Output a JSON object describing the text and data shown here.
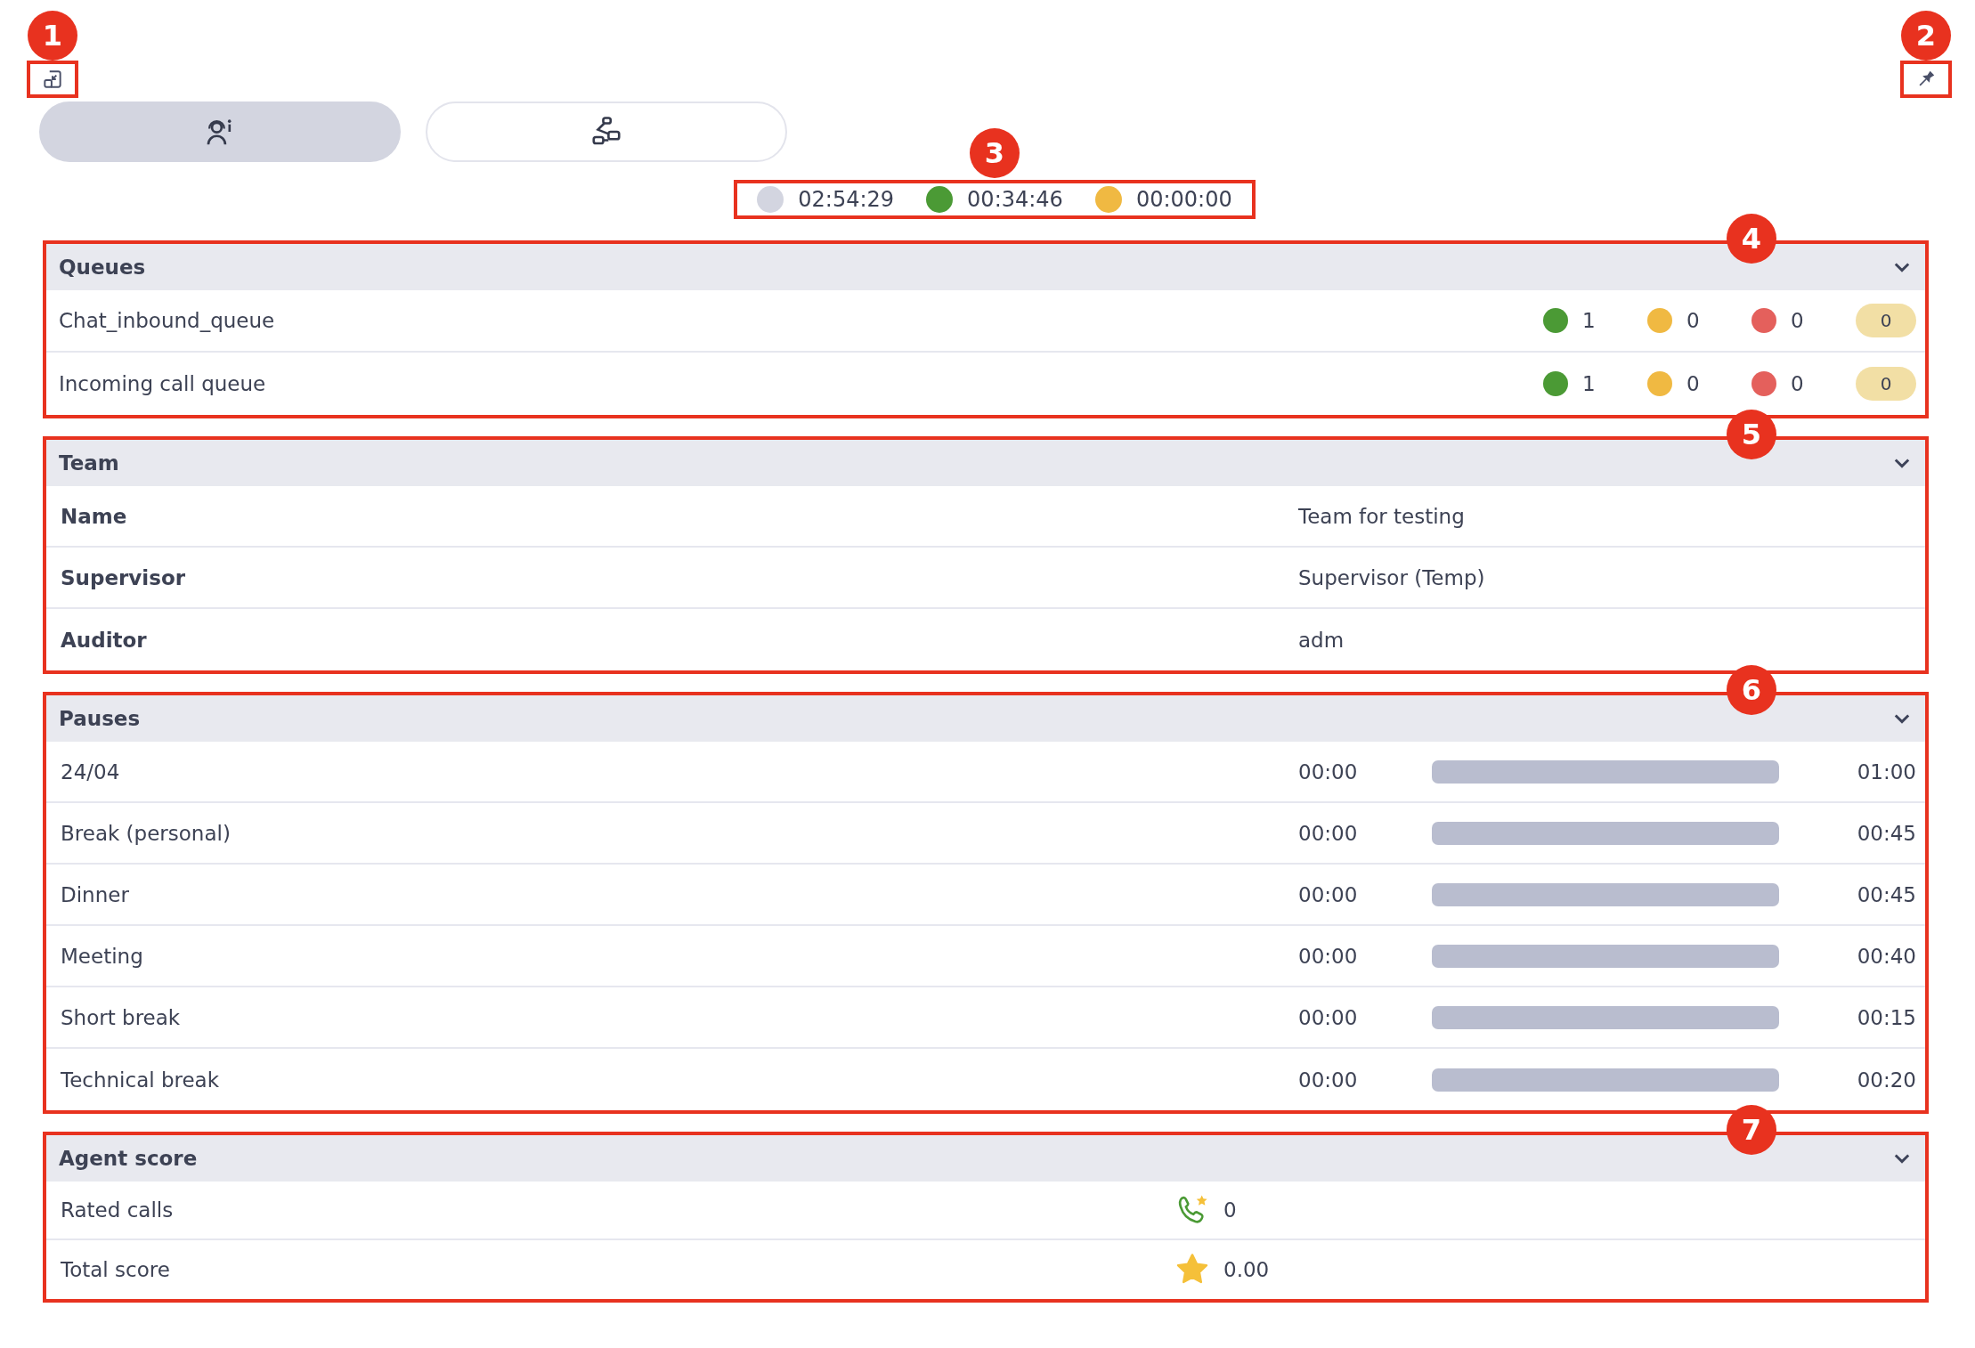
{
  "top_bar": {
    "left_callout": "1",
    "right_callout": "2"
  },
  "tabs": [
    {
      "kind": "agent",
      "selected": true
    },
    {
      "kind": "flow",
      "selected": false
    }
  ],
  "timers": {
    "callout": "3",
    "items": [
      {
        "color": "#d3d5e0",
        "value": "02:54:29"
      },
      {
        "color": "#4b9a35",
        "value": "00:34:46"
      },
      {
        "color": "#f0b942",
        "value": "00:00:00"
      }
    ]
  },
  "queues": {
    "title": "Queues",
    "callout": "4",
    "expanded": true,
    "rows": [
      {
        "name": "Chat_inbound_queue",
        "counts": [
          {
            "color": "#4b9a35",
            "value": "1"
          },
          {
            "color": "#f0b942",
            "value": "0"
          },
          {
            "color": "#e4605c",
            "value": "0"
          }
        ],
        "badge": "0"
      },
      {
        "name": "Incoming call queue",
        "counts": [
          {
            "color": "#4b9a35",
            "value": "1"
          },
          {
            "color": "#f0b942",
            "value": "0"
          },
          {
            "color": "#e4605c",
            "value": "0"
          }
        ],
        "badge": "0"
      }
    ]
  },
  "team": {
    "title": "Team",
    "callout": "5",
    "expanded": true,
    "rows": [
      {
        "label": "Name",
        "value": "Team for testing"
      },
      {
        "label": "Supervisor",
        "value": "Supervisor (Temp)"
      },
      {
        "label": "Auditor",
        "value": "adm"
      }
    ]
  },
  "pauses": {
    "title": "Pauses",
    "callout": "6",
    "expanded": true,
    "rows": [
      {
        "name": "24/04",
        "used": "00:00",
        "level": 0,
        "limit": "01:00"
      },
      {
        "name": "Break (personal)",
        "used": "00:00",
        "level": 0,
        "limit": "00:45"
      },
      {
        "name": "Dinner",
        "used": "00:00",
        "level": 0,
        "limit": "00:45"
      },
      {
        "name": "Meeting",
        "used": "00:00",
        "level": 0,
        "limit": "00:40"
      },
      {
        "name": "Short break",
        "used": "00:00",
        "level": 0,
        "limit": "00:15"
      },
      {
        "name": "Technical break",
        "used": "00:00",
        "level": 0,
        "limit": "00:20"
      }
    ]
  },
  "agent_score": {
    "title": "Agent score",
    "callout": "7",
    "expanded": true,
    "rows": [
      {
        "kind": "calls",
        "label": "Rated calls",
        "value": "0"
      },
      {
        "kind": "score",
        "label": "Total score",
        "value": "0.00"
      }
    ]
  }
}
